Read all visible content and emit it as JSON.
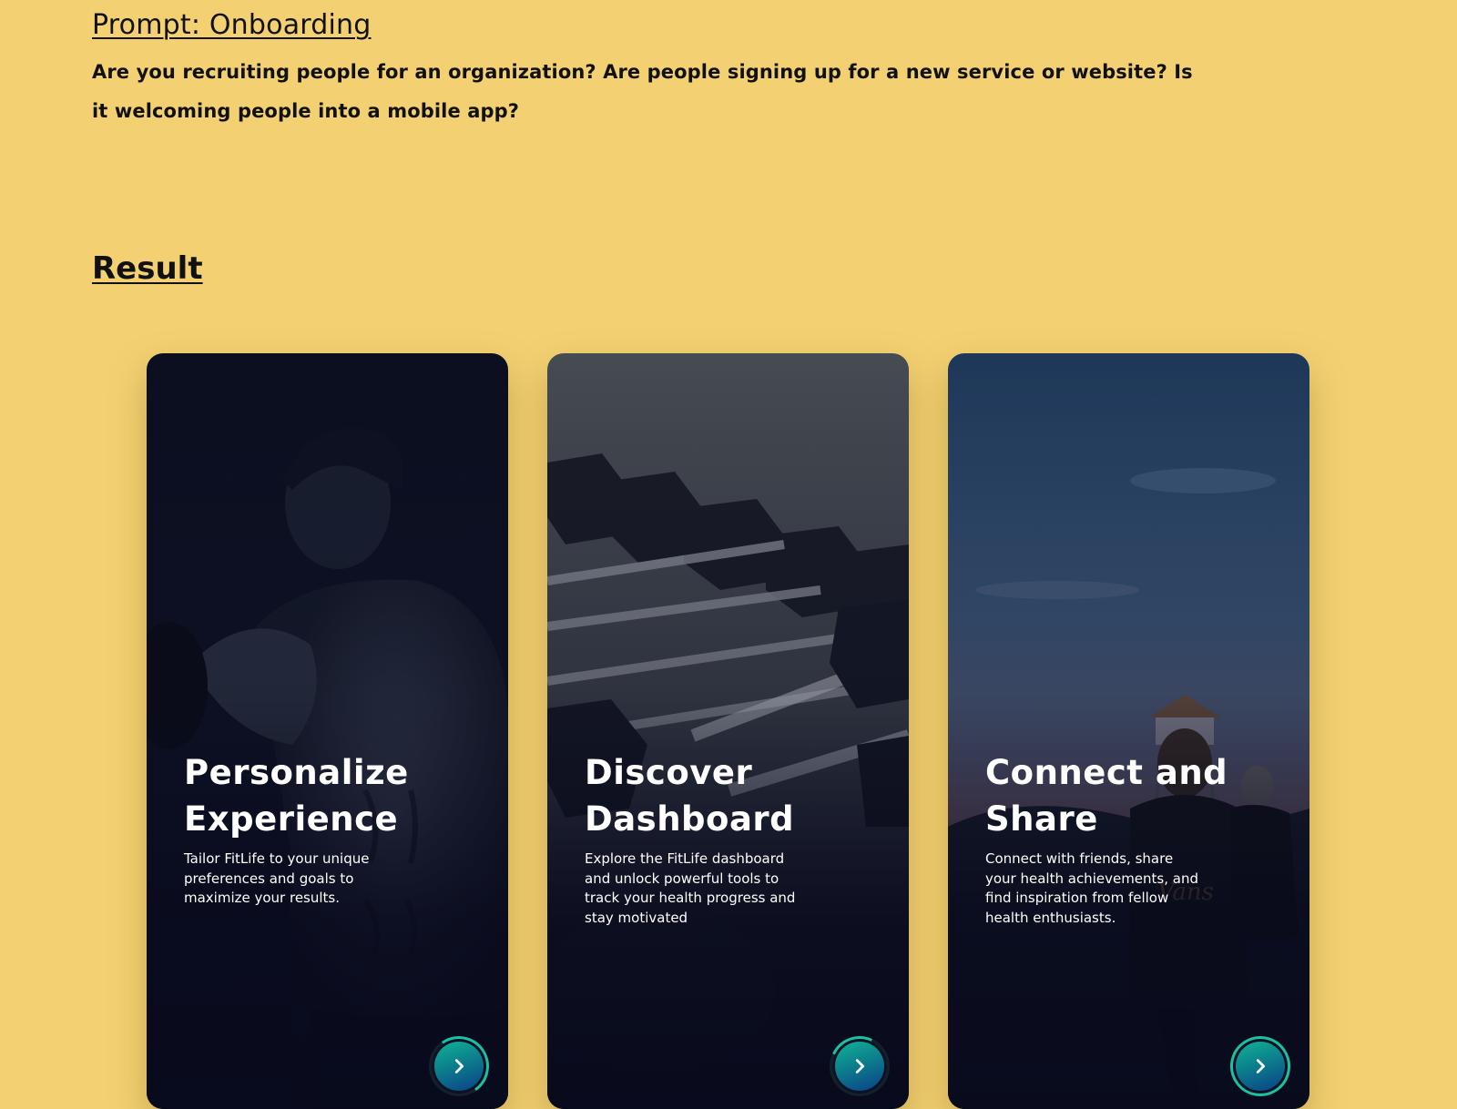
{
  "prompt": {
    "title": "Prompt: Onboarding",
    "body": "Are you recruiting people for an organization? Are people signing up for a new service or website? Is it welcoming people into a mobile app?"
  },
  "result": {
    "title": "Result"
  },
  "cards": [
    {
      "title": "Personalize Experience",
      "description": "Tailor FitLife to your unique preferences and goals to maximize your results.",
      "image": "man-lifting-weights-photo",
      "button_icon": "chevron-right-icon"
    },
    {
      "title": "Discover Dashboard",
      "description": "Explore the FitLife dashboard and unlock powerful tools to track your health progress and stay motivated",
      "image": "dumbbell-rack-photo",
      "button_icon": "chevron-right-icon"
    },
    {
      "title": "Connect and Share",
      "description": "Connect with friends, share your health achievements, and find inspiration from fellow health enthusiasts.",
      "image": "beach-walkers-photo",
      "button_icon": "chevron-right-icon"
    }
  ],
  "colors": {
    "page_background": "#f3d173",
    "card_overlay": "#080a1c",
    "button_gradient_start": "#10b395",
    "button_gradient_end": "#0a3f88",
    "progress_ring": "#1cc0a0"
  }
}
